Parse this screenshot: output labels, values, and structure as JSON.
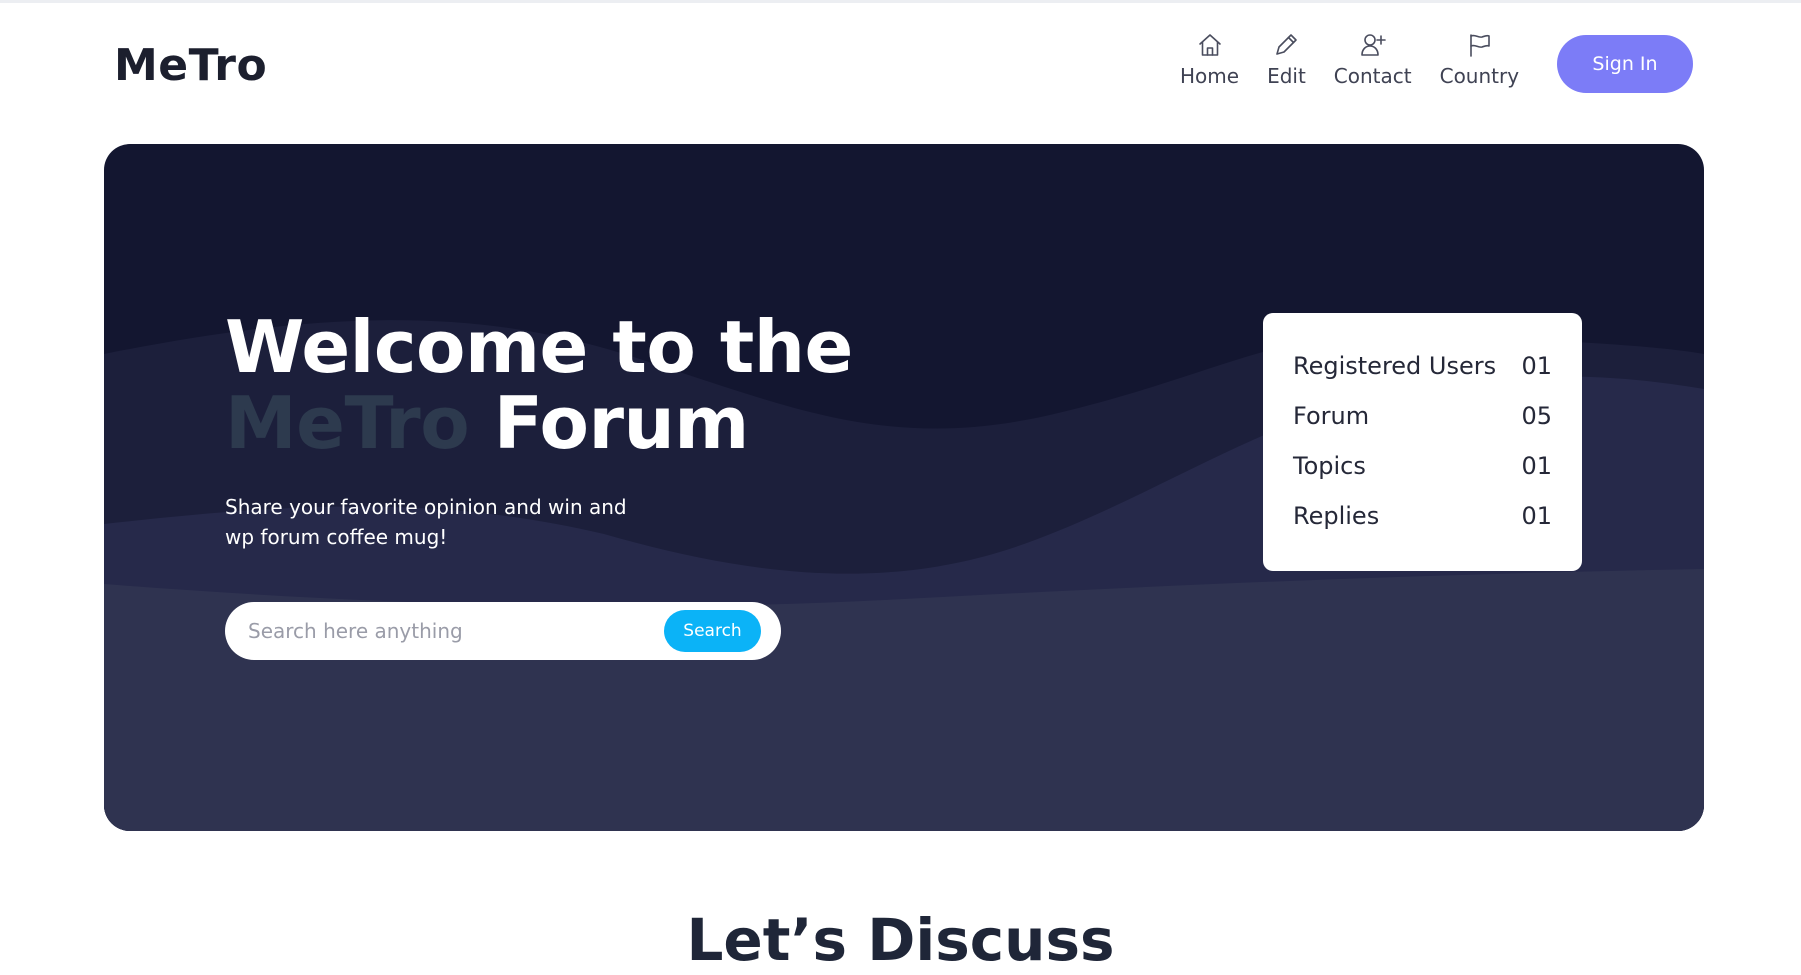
{
  "header": {
    "logo": "MeTro",
    "nav": [
      {
        "label": "Home",
        "icon": "home-icon"
      },
      {
        "label": "Edit",
        "icon": "pencil-icon"
      },
      {
        "label": "Contact",
        "icon": "user-plus-icon"
      },
      {
        "label": "Country",
        "icon": "flag-icon"
      }
    ],
    "signin_label": "Sign In"
  },
  "hero": {
    "title_line1": "Welcome to the",
    "title_brand": "MeTro",
    "title_rest": "Forum",
    "subtitle": "Share your favorite opinion and win and wp forum coffee mug!",
    "search": {
      "placeholder": "Search here anything",
      "button_label": "Search"
    }
  },
  "stats": [
    {
      "label": "Registered Users",
      "value": "01"
    },
    {
      "label": "Forum",
      "value": "05"
    },
    {
      "label": "Topics",
      "value": "01"
    },
    {
      "label": "Replies",
      "value": "01"
    }
  ],
  "section": {
    "title": "Let’s Discuss"
  },
  "colors": {
    "accent": "#7c7cf7",
    "search_button": "#0bb3f7",
    "hero_dark": "#131630",
    "hero_wave": "#2f3350",
    "brand_muted": "#2d3a4e"
  }
}
